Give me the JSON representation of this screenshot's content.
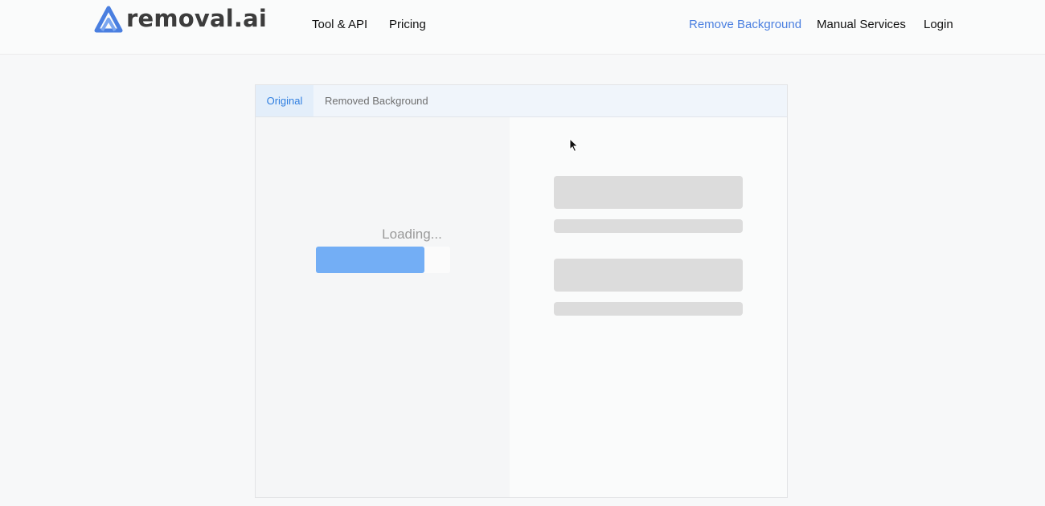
{
  "header": {
    "logo_text": "removal.ai",
    "nav_left": [
      {
        "label": "Tool & API"
      },
      {
        "label": "Pricing"
      }
    ],
    "nav_right": [
      {
        "label": "Remove Background",
        "active": true
      },
      {
        "label": "Manual Services"
      },
      {
        "label": "Login"
      }
    ]
  },
  "panel": {
    "tabs": [
      {
        "label": "Original",
        "selected": true
      },
      {
        "label": "Removed Background"
      }
    ],
    "loading": {
      "text": "Loading...",
      "progress_fraction": 0.81
    },
    "skeleton_placeholder_count": 4
  },
  "colors": {
    "brand_blue": "#4a7fe0",
    "tab_active": "#2f7ee0",
    "progress": "#73aef5",
    "skeleton": "#dcdcdc"
  },
  "icons": [
    "logo-icon",
    "cursor-pointer-icon"
  ]
}
